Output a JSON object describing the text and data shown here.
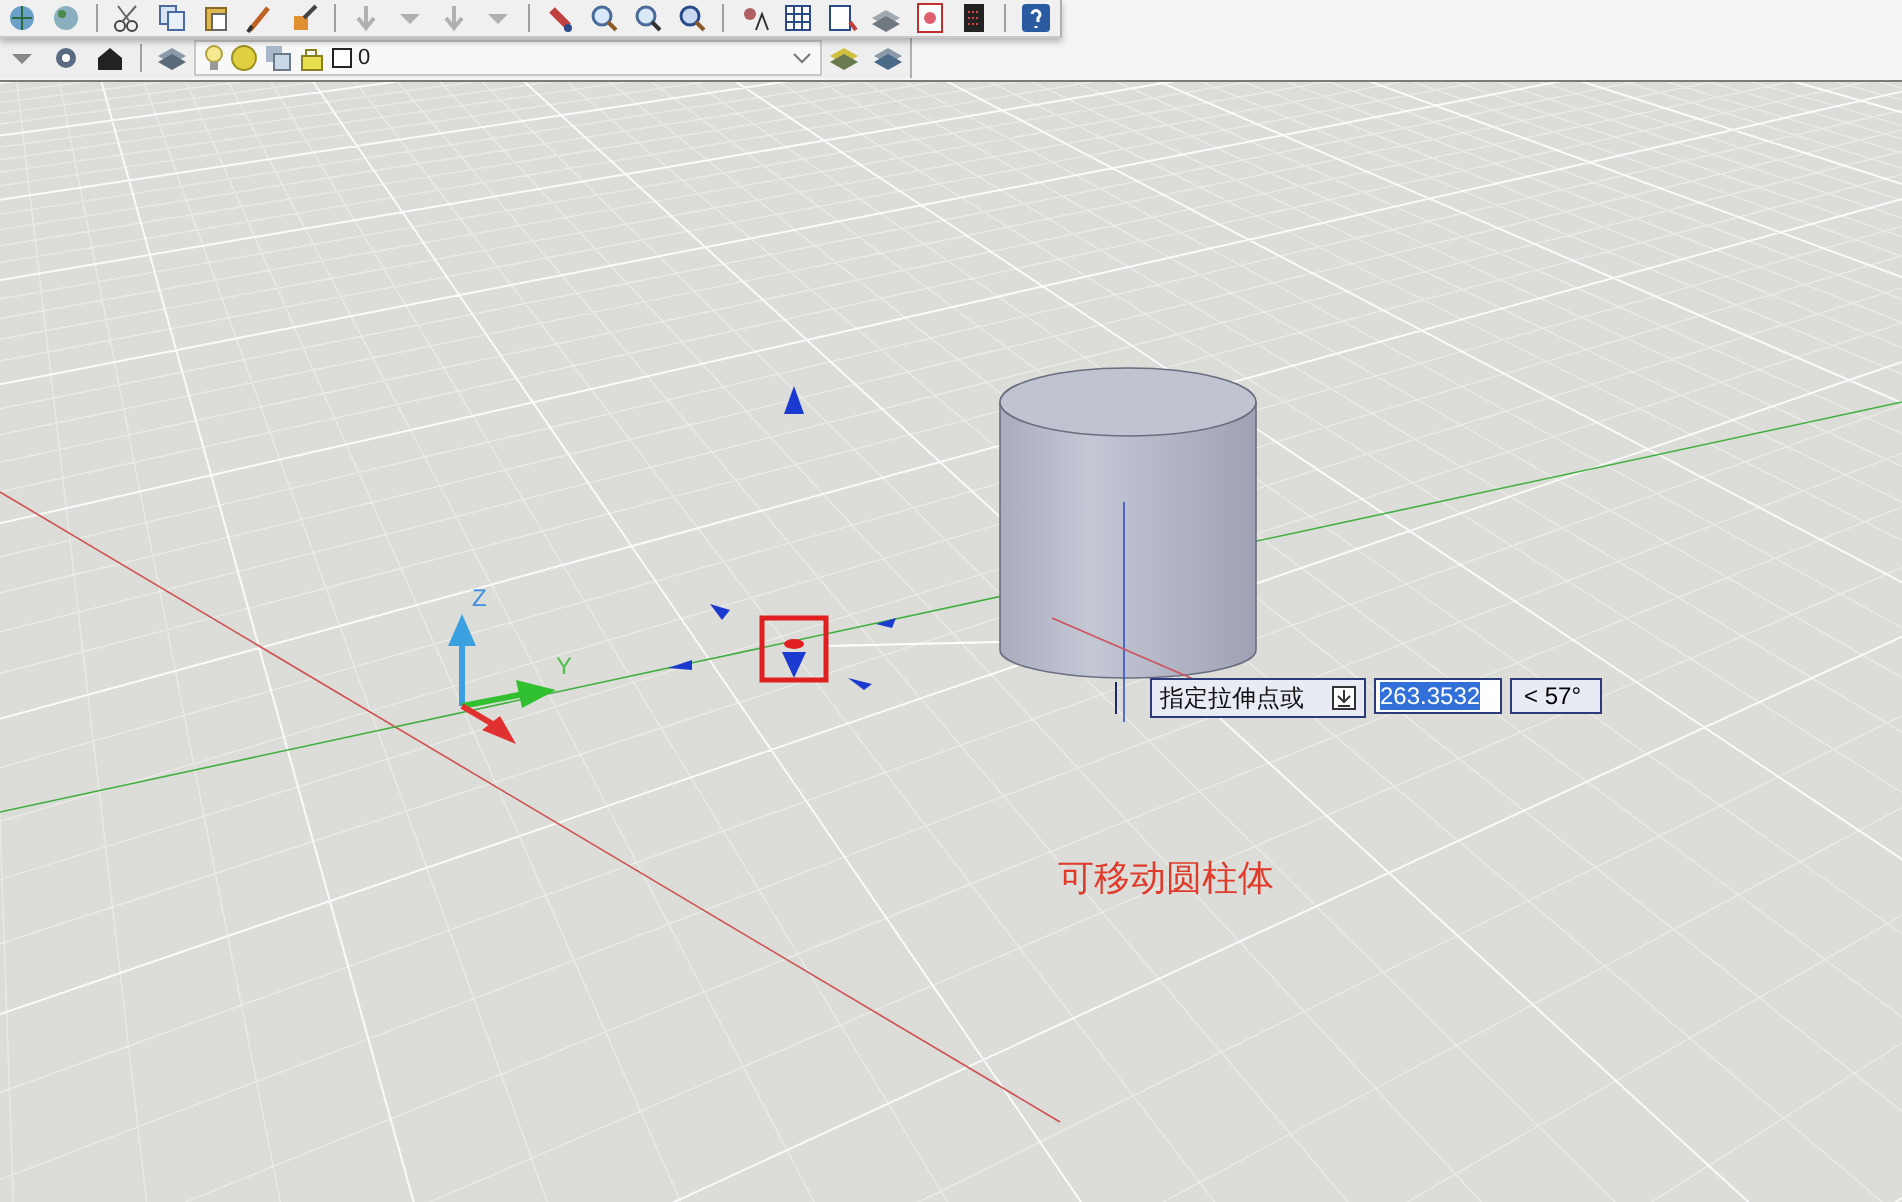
{
  "toolbar": {
    "layer_dropdown": {
      "value": "0"
    }
  },
  "viewport": {
    "axis_labels": [
      "Z",
      "Y"
    ],
    "grip_highlighted": true,
    "dynamic_input": {
      "prompt": "指定拉伸点或",
      "distance": "263.3532",
      "angle": "< 57°"
    },
    "caption": "可移动圆柱体"
  }
}
